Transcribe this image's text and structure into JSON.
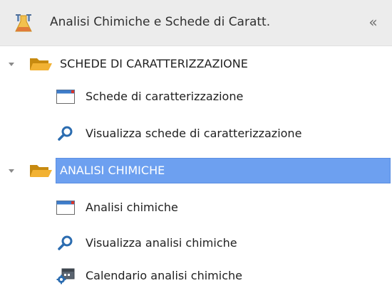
{
  "header": {
    "title": "Analisi Chimiche e Schede di Caratt.",
    "icon": "lab-flask-icon",
    "collapse_label": "«"
  },
  "groups": [
    {
      "label": "SCHEDE DI CARATTERIZZAZIONE",
      "expanded": true,
      "selected": false,
      "items": [
        {
          "label": "Schede di caratterizzazione",
          "icon": "window-form-icon"
        },
        {
          "label": "Visualizza schede di caratterizzazione",
          "icon": "search-icon"
        }
      ]
    },
    {
      "label": "ANALISI CHIMICHE",
      "expanded": true,
      "selected": true,
      "items": [
        {
          "label": "Analisi chimiche",
          "icon": "window-form-icon"
        },
        {
          "label": "Visualizza analisi chimiche",
          "icon": "search-icon"
        },
        {
          "label": "Calendario analisi chimiche",
          "icon": "calendar-gear-icon"
        }
      ]
    }
  ],
  "colors": {
    "header_bg": "#ececec",
    "selection_bg": "#6da0f0",
    "folder": "#e8a317",
    "search_icon": "#2b6cb0"
  }
}
